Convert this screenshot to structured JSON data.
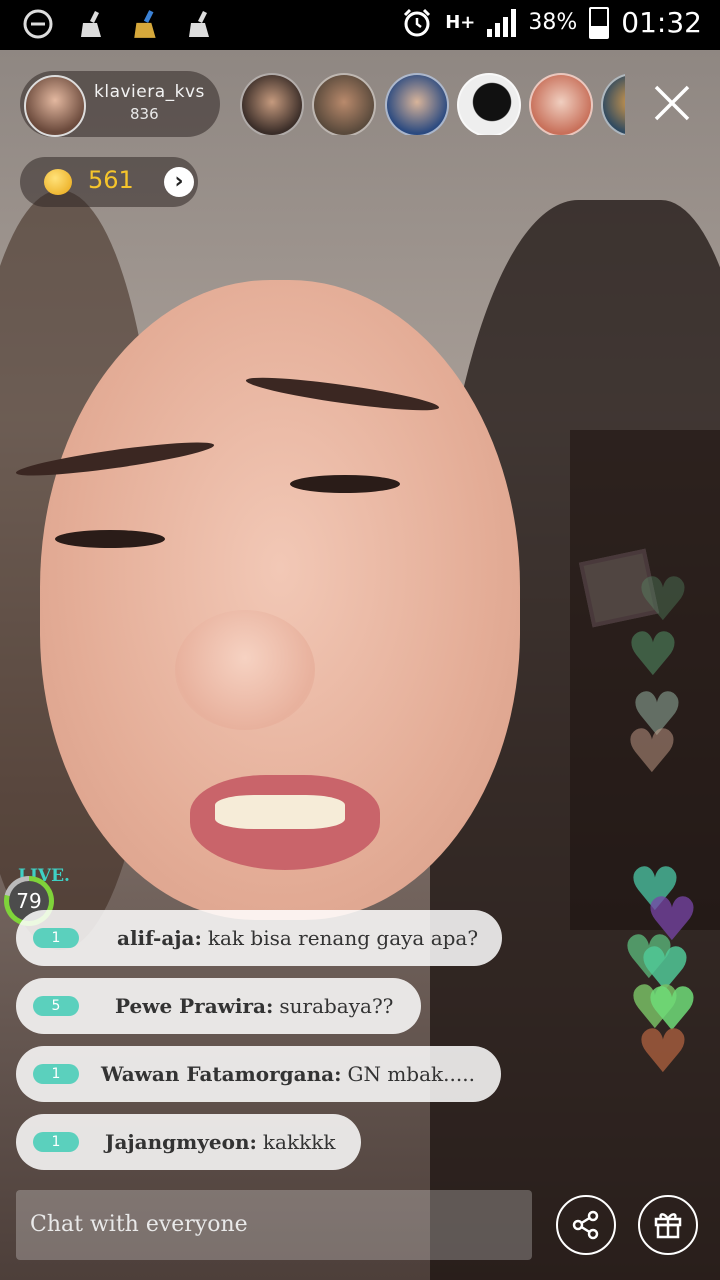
{
  "status_bar": {
    "battery_percent": "38%",
    "time": "01:32",
    "network_label": "H+",
    "icons": [
      "minus-circle-icon",
      "broom-icon",
      "broom-color-icon",
      "broom-icon",
      "alarm-icon",
      "signal-icon",
      "battery-icon"
    ],
    "battery_level": 0.38
  },
  "host": {
    "username": "klaviera_kvs",
    "viewer_count": "836"
  },
  "viewers": {
    "avatars": [
      "viewer-avatar-1",
      "viewer-avatar-2",
      "viewer-avatar-3",
      "viewer-avatar-4",
      "viewer-avatar-5",
      "viewer-avatar-6"
    ]
  },
  "coins": {
    "amount": "561"
  },
  "live": {
    "label": "LIVE.",
    "level": "79",
    "progress": 0.79
  },
  "chat": {
    "messages": [
      {
        "level": "1",
        "user": "alif-aja:",
        "text": "kak bisa renang gaya apa?"
      },
      {
        "level": "5",
        "user": "Pewe Prawira:",
        "text": "surabaya??"
      },
      {
        "level": "1",
        "user": "Wawan Fatamorgana:",
        "text": "GN mbak....."
      },
      {
        "level": "1",
        "user": "Jajangmyeon:",
        "text": "kakkkk"
      }
    ],
    "input_placeholder": "Chat with everyone"
  },
  "colors": {
    "level_badge": "#5bd0bd",
    "coin_text": "#f6c52b",
    "live_text": "#3fd0c4"
  }
}
